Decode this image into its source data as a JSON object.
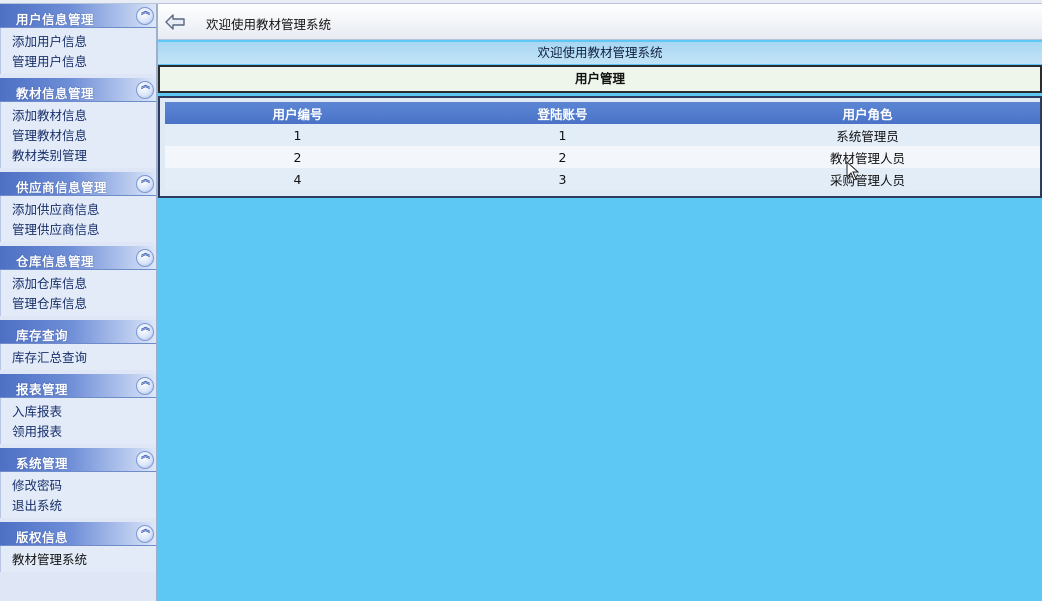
{
  "app": {
    "header_title": "欢迎使用教材管理系统"
  },
  "sidebar": {
    "groups": [
      {
        "title": "用户信息管理",
        "items": [
          "添加用户信息",
          "管理用户信息"
        ]
      },
      {
        "title": "教材信息管理",
        "items": [
          "添加教材信息",
          "管理教材信息",
          "教材类别管理"
        ]
      },
      {
        "title": "供应商信息管理",
        "items": [
          "添加供应商信息",
          "管理供应商信息"
        ]
      },
      {
        "title": "仓库信息管理",
        "items": [
          "添加仓库信息",
          "管理仓库信息"
        ]
      },
      {
        "title": "库存查询",
        "items": [
          "库存汇总查询"
        ]
      },
      {
        "title": "报表管理",
        "items": [
          "入库报表",
          "领用报表"
        ]
      },
      {
        "title": "系统管理",
        "items": [
          "修改密码",
          "退出系统"
        ]
      },
      {
        "title": "版权信息",
        "items": [
          "教材管理系统"
        ]
      }
    ]
  },
  "main": {
    "welcome": "欢迎使用教材管理系统",
    "section_title": "用户管理",
    "table": {
      "headers": [
        "用户编号",
        "登陆账号",
        "用户角色"
      ],
      "rows": [
        [
          "1",
          "1",
          "系统管理员"
        ],
        [
          "2",
          "2",
          "教材管理人员"
        ],
        [
          "4",
          "3",
          "采购管理人员"
        ]
      ]
    }
  },
  "icons": {
    "back": "back-arrow-icon",
    "collapse": "chevron-double-up-icon"
  },
  "colors": {
    "page_background": "#5ec8f4",
    "group_header": "#4e70c4",
    "table_header": "#5c86d4"
  }
}
